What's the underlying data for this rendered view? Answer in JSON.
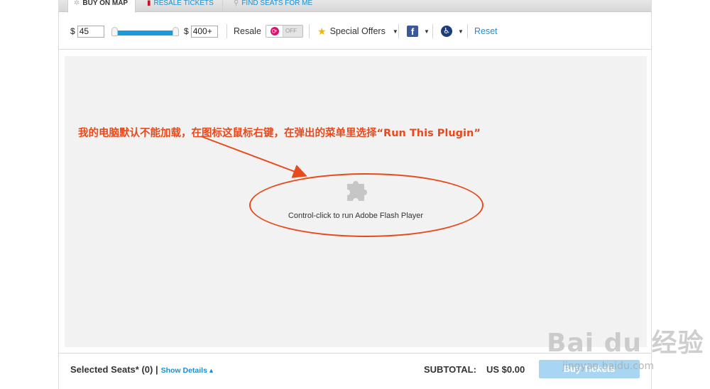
{
  "tabs": [
    {
      "icon": "gear-icon",
      "glyph": "✲",
      "label": "BUY ON MAP"
    },
    {
      "icon": "nba-logo-icon",
      "glyph": "▮",
      "label": "RESALE TICKETS"
    },
    {
      "icon": "search-icon",
      "glyph": "⚲",
      "label": "FIND SEATS FOR ME"
    }
  ],
  "filters": {
    "currency_symbol": "$",
    "price_min": "45",
    "price_max": "400+",
    "resale_label": "Resale",
    "resale_toggle_state": "OFF",
    "special_offers_label": "Special Offers",
    "reset_label": "Reset"
  },
  "plugin": {
    "message": "Control-click to run Adobe Flash Player"
  },
  "annotation": {
    "text": "我的电脑默认不能加载，在图标这鼠标右键，在弹出的菜单里选择“Run This Plugin”",
    "color": "#e84a1c"
  },
  "footer": {
    "selected_seats": "Selected Seats* (0) |",
    "show_details": "Show Details ▴",
    "subtotal_label": "SUBTOTAL:",
    "subtotal_value": "US $0.00",
    "buy_button": "Buy Tickets"
  },
  "watermark": {
    "main": "Bai du 经验",
    "sub": "jingyan.baidu.com"
  },
  "colors": {
    "link": "#1a8fd0",
    "slider": "#1a9ad8",
    "toggle_icon": "#d3166f",
    "buy_button": "#a8d6f2"
  }
}
